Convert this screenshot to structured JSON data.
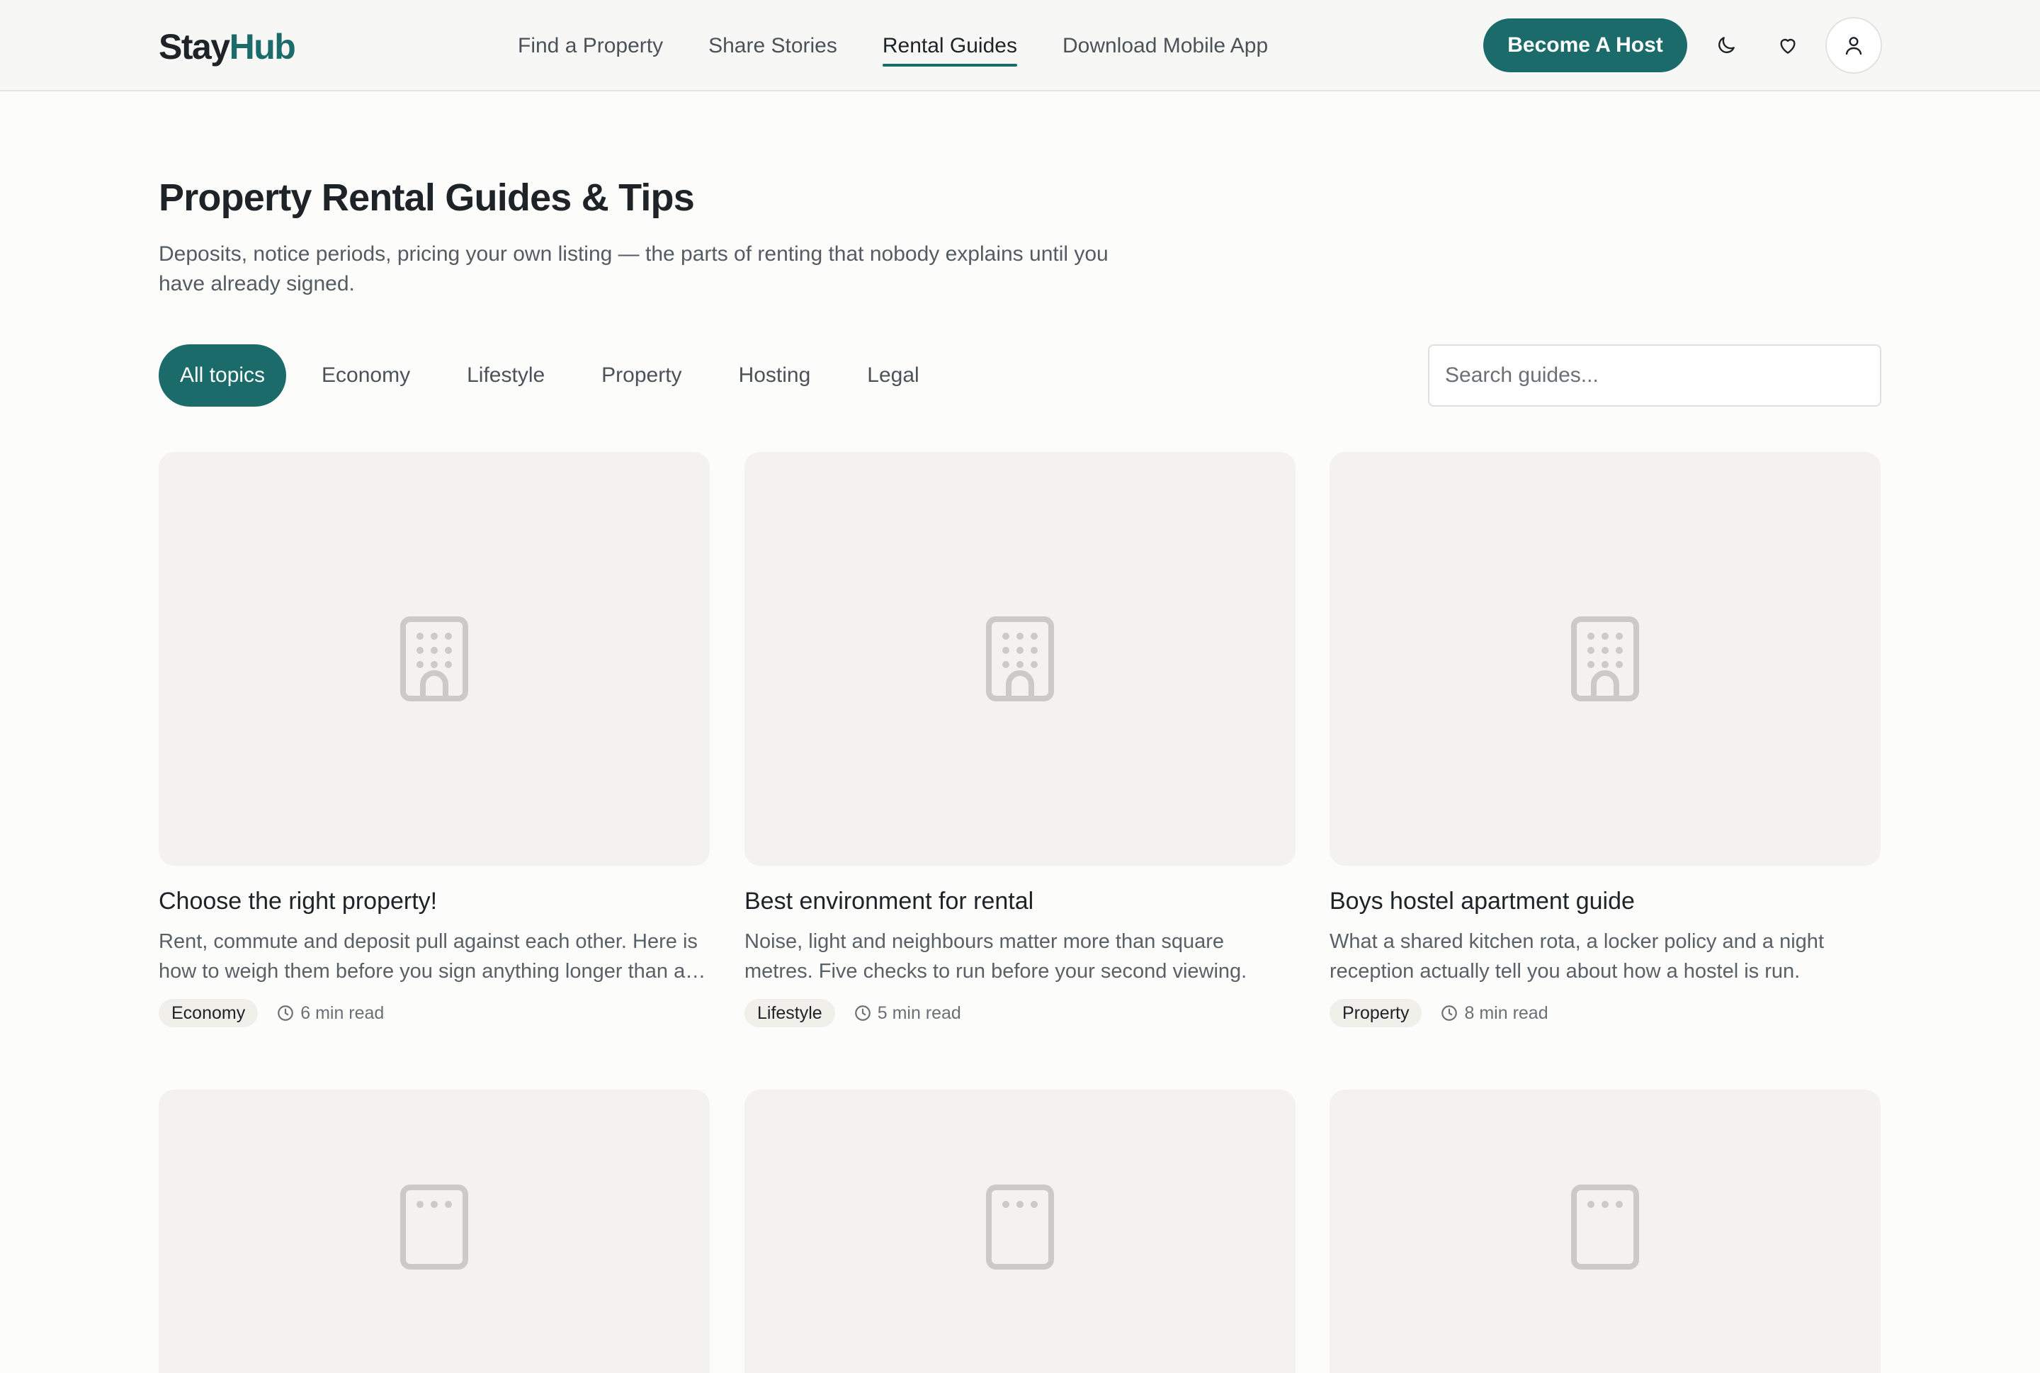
{
  "brand": {
    "part1": "Stay",
    "part2": "Hub",
    "accent": "#1c6b6b"
  },
  "nav": {
    "items": [
      {
        "label": "Find a Property",
        "active": false
      },
      {
        "label": "Share Stories",
        "active": false
      },
      {
        "label": "Rental Guides",
        "active": true
      },
      {
        "label": "Download Mobile App",
        "active": false
      }
    ],
    "host_button": "Become A Host",
    "icons": [
      "moon-icon",
      "heart-icon",
      "user-icon"
    ]
  },
  "page": {
    "title": "Property Rental Guides & Tips",
    "description": "Deposits, notice periods, pricing your own listing — the parts of renting that nobody explains until you have already signed."
  },
  "filters": {
    "chips": [
      "All topics",
      "Economy",
      "Lifestyle",
      "Property",
      "Hosting",
      "Legal"
    ],
    "active": "All topics",
    "search_placeholder": "Search guides..."
  },
  "guides": [
    {
      "title": "Choose the right property!",
      "excerpt": "Rent, commute and deposit pull against each other. Here is how to weigh them before you sign anything longer than a…",
      "tag": "Economy",
      "read_time": "6 min read"
    },
    {
      "title": "Best environment for rental",
      "excerpt": "Noise, light and neighbours matter more than square metres. Five checks to run before your second viewing.",
      "tag": "Lifestyle",
      "read_time": "5 min read"
    },
    {
      "title": "Boys hostel apartment guide",
      "excerpt": "What a shared kitchen rota, a locker policy and a night reception actually tell you about how a hostel is run.",
      "tag": "Property",
      "read_time": "8 min read"
    }
  ]
}
